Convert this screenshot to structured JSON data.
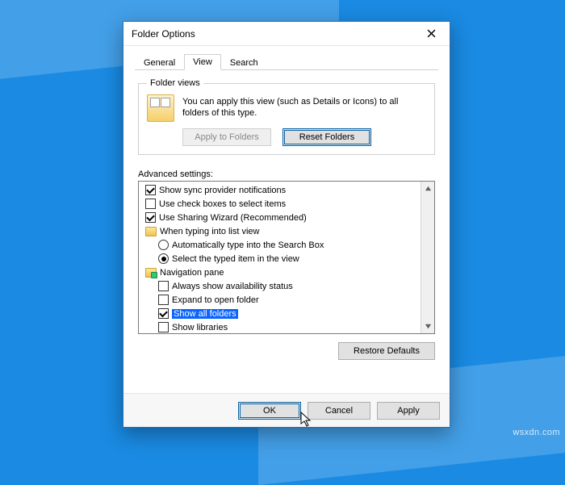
{
  "window": {
    "title": "Folder Options"
  },
  "tabs": {
    "general": "General",
    "view": "View",
    "search": "Search"
  },
  "folderViews": {
    "legend": "Folder views",
    "text": "You can apply this view (such as Details or Icons) to all folders of this type.",
    "apply": "Apply to Folders",
    "reset": "Reset Folders"
  },
  "advanced": {
    "label": "Advanced settings:",
    "items": {
      "syncProvider": "Show sync provider notifications",
      "checkBoxes": "Use check boxes to select items",
      "sharingWizard": "Use Sharing Wizard (Recommended)",
      "typingGroup": "When typing into list view",
      "typingAuto": "Automatically type into the Search Box",
      "typingSelect": "Select the typed item in the view",
      "navGroup": "Navigation pane",
      "navAvail": "Always show availability status",
      "navExpand": "Expand to open folder",
      "navShowAll": "Show all folders",
      "navLibraries": "Show libraries"
    }
  },
  "buttons": {
    "restore": "Restore Defaults",
    "ok": "OK",
    "cancel": "Cancel",
    "apply": "Apply"
  },
  "watermark": "wsxdn.com"
}
